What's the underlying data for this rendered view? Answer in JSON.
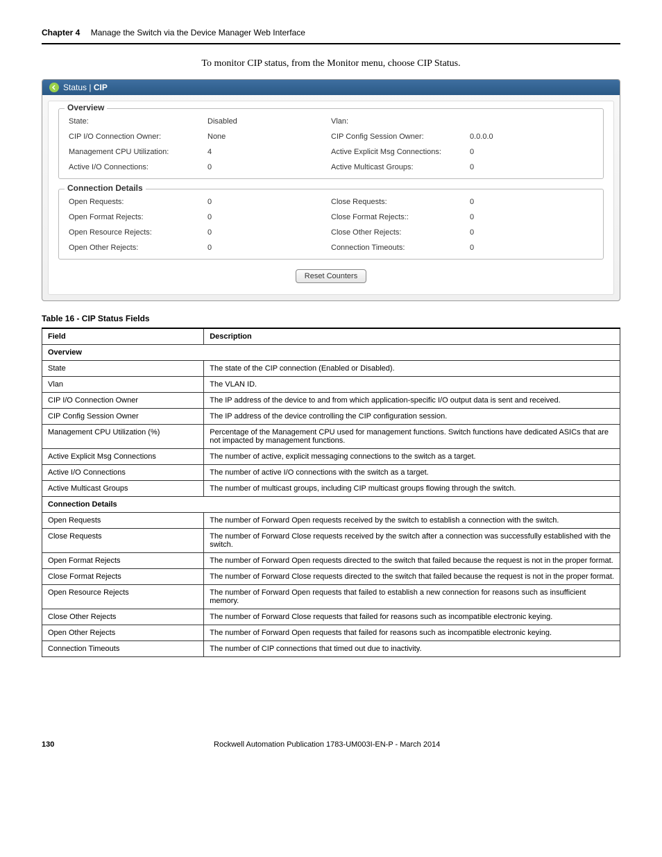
{
  "header": {
    "chapter": "Chapter 4",
    "title": "Manage the Switch via the Device Manager Web Interface"
  },
  "intro": "To monitor CIP status, from the Monitor menu, choose CIP Status.",
  "panel": {
    "breadcrumb_status": "Status",
    "breadcrumb_sep": " | ",
    "breadcrumb_cip": "CIP",
    "overview_legend": "Overview",
    "overview": {
      "state_label": "State:",
      "state_value": "Disabled",
      "vlan_label": "Vlan:",
      "vlan_value": "",
      "cip_io_owner_label": "CIP I/O Connection Owner:",
      "cip_io_owner_value": "None",
      "cip_cfg_owner_label": "CIP Config Session Owner:",
      "cip_cfg_owner_value": "0.0.0.0",
      "cpu_util_label": "Management CPU Utilization:",
      "cpu_util_value": "4",
      "active_explicit_label": "Active Explicit Msg Connections:",
      "active_explicit_value": "0",
      "active_io_label": "Active I/O Connections:",
      "active_io_value": "0",
      "active_multicast_label": "Active Multicast Groups:",
      "active_multicast_value": "0"
    },
    "details_legend": "Connection Details",
    "details": {
      "open_req_label": "Open Requests:",
      "open_req_value": "0",
      "close_req_label": "Close Requests:",
      "close_req_value": "0",
      "open_fmt_label": "Open Format Rejects:",
      "open_fmt_value": "0",
      "close_fmt_label": "Close Format Rejects::",
      "close_fmt_value": "0",
      "open_res_label": "Open Resource Rejects:",
      "open_res_value": "0",
      "close_other_label": "Close Other Rejects:",
      "close_other_value": "0",
      "open_other_label": "Open Other Rejects:",
      "open_other_value": "0",
      "conn_timeout_label": "Connection Timeouts:",
      "conn_timeout_value": "0"
    },
    "reset_button": "Reset Counters"
  },
  "table_title": "Table 16 - CIP Status Fields",
  "table_headers": {
    "field": "Field",
    "description": "Description"
  },
  "section_overview": "Overview",
  "section_details": "Connection Details",
  "rows_overview": [
    {
      "f": "State",
      "d": "The state of the CIP connection (Enabled or Disabled)."
    },
    {
      "f": "Vlan",
      "d": "The VLAN ID."
    },
    {
      "f": "CIP I/O Connection Owner",
      "d": "The IP address of the device to and from which application-specific I/O output data is sent and received."
    },
    {
      "f": "CIP Config Session Owner",
      "d": "The IP address of the device controlling the CIP configuration session."
    },
    {
      "f": "Management CPU Utilization (%)",
      "d": "Percentage of the Management CPU used for management functions. Switch functions have dedicated ASICs that are not impacted by management functions."
    },
    {
      "f": "Active Explicit Msg Connections",
      "d": "The number of active, explicit messaging connections to the switch as a target."
    },
    {
      "f": "Active I/O Connections",
      "d": "The number of active I/O connections with the switch as a target."
    },
    {
      "f": "Active Multicast Groups",
      "d": "The number of multicast groups, including CIP multicast groups flowing through the switch."
    }
  ],
  "rows_details": [
    {
      "f": "Open Requests",
      "d": "The number of Forward Open requests received by the switch to establish a connection with the switch."
    },
    {
      "f": "Close Requests",
      "d": "The number of Forward Close requests received by the switch after a connection was successfully established with the switch."
    },
    {
      "f": "Open Format Rejects",
      "d": "The number of Forward Open requests directed to the switch that failed because the request is not in the proper format."
    },
    {
      "f": "Close Format Rejects",
      "d": "The number of Forward Close requests directed to the switch that failed because the request is not in the proper format."
    },
    {
      "f": "Open Resource Rejects",
      "d": "The number of Forward Open requests that failed to establish a new connection for reasons such as insufficient memory."
    },
    {
      "f": "Close Other Rejects",
      "d": "The number of Forward Close requests that failed for reasons such as incompatible electronic keying."
    },
    {
      "f": "Open Other Rejects",
      "d": "The number of Forward Open requests that failed for reasons such as incompatible electronic keying."
    },
    {
      "f": "Connection Timeouts",
      "d": "The number of CIP connections that timed out due to inactivity."
    }
  ],
  "footer": {
    "page": "130",
    "pub": "Rockwell Automation Publication 1783-UM003I-EN-P - March 2014"
  }
}
